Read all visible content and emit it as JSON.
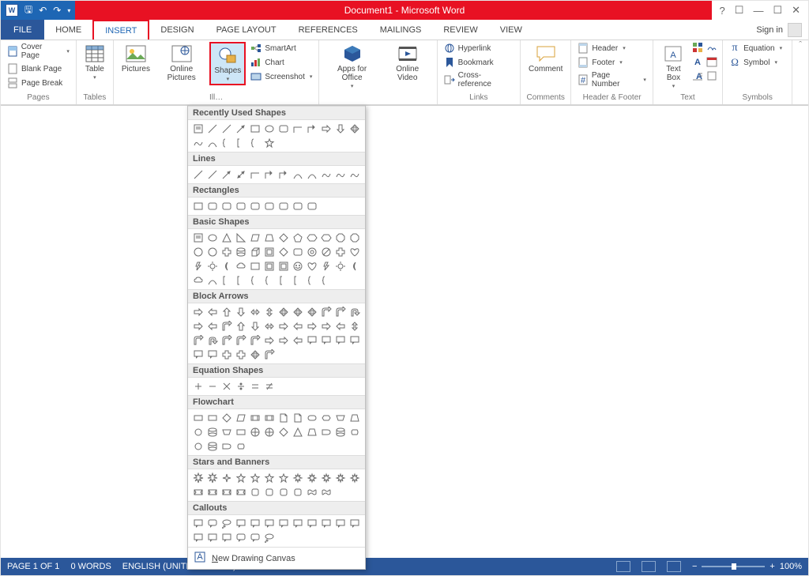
{
  "title": "Document1 - Microsoft Word",
  "tabs": {
    "file": "FILE",
    "home": "HOME",
    "insert": "INSERT",
    "design": "DESIGN",
    "layout": "PAGE LAYOUT",
    "refs": "REFERENCES",
    "mail": "MAILINGS",
    "review": "REVIEW",
    "view": "VIEW"
  },
  "signin": "Sign in",
  "ribbon": {
    "pages": {
      "cover": "Cover Page",
      "blank": "Blank Page",
      "break": "Page Break",
      "lbl": "Pages"
    },
    "tables": {
      "table": "Table",
      "lbl": "Tables"
    },
    "ill": {
      "pic": "Pictures",
      "online": "Online Pictures",
      "shapes": "Shapes",
      "smart": "SmartArt",
      "chart": "Chart",
      "screen": "Screenshot",
      "lbl": "Ill…"
    },
    "apps": {
      "apps": "Apps for Office",
      "video": "Online Video"
    },
    "links": {
      "hyper": "Hyperlink",
      "book": "Bookmark",
      "cross": "Cross-reference",
      "lbl": "Links"
    },
    "comments": {
      "comment": "Comment",
      "lbl": "Comments"
    },
    "hf": {
      "header": "Header",
      "footer": "Footer",
      "page": "Page Number",
      "lbl": "Header & Footer"
    },
    "text": {
      "box": "Text Box",
      "lbl": "Text"
    },
    "symbols": {
      "eq": "Equation",
      "sym": "Symbol",
      "lbl": "Symbols"
    }
  },
  "shapesMenu": {
    "recent": "Recently Used Shapes",
    "lines": "Lines",
    "rects": "Rectangles",
    "basic": "Basic Shapes",
    "block": "Block Arrows",
    "eq": "Equation Shapes",
    "flow": "Flowchart",
    "stars": "Stars and Banners",
    "call": "Callouts",
    "newcanvas": "New Drawing Canvas"
  },
  "status": {
    "page": "PAGE 1 OF 1",
    "words": "0 WORDS",
    "lang": "ENGLISH (UNITED STATES)",
    "zoom": "100%"
  }
}
